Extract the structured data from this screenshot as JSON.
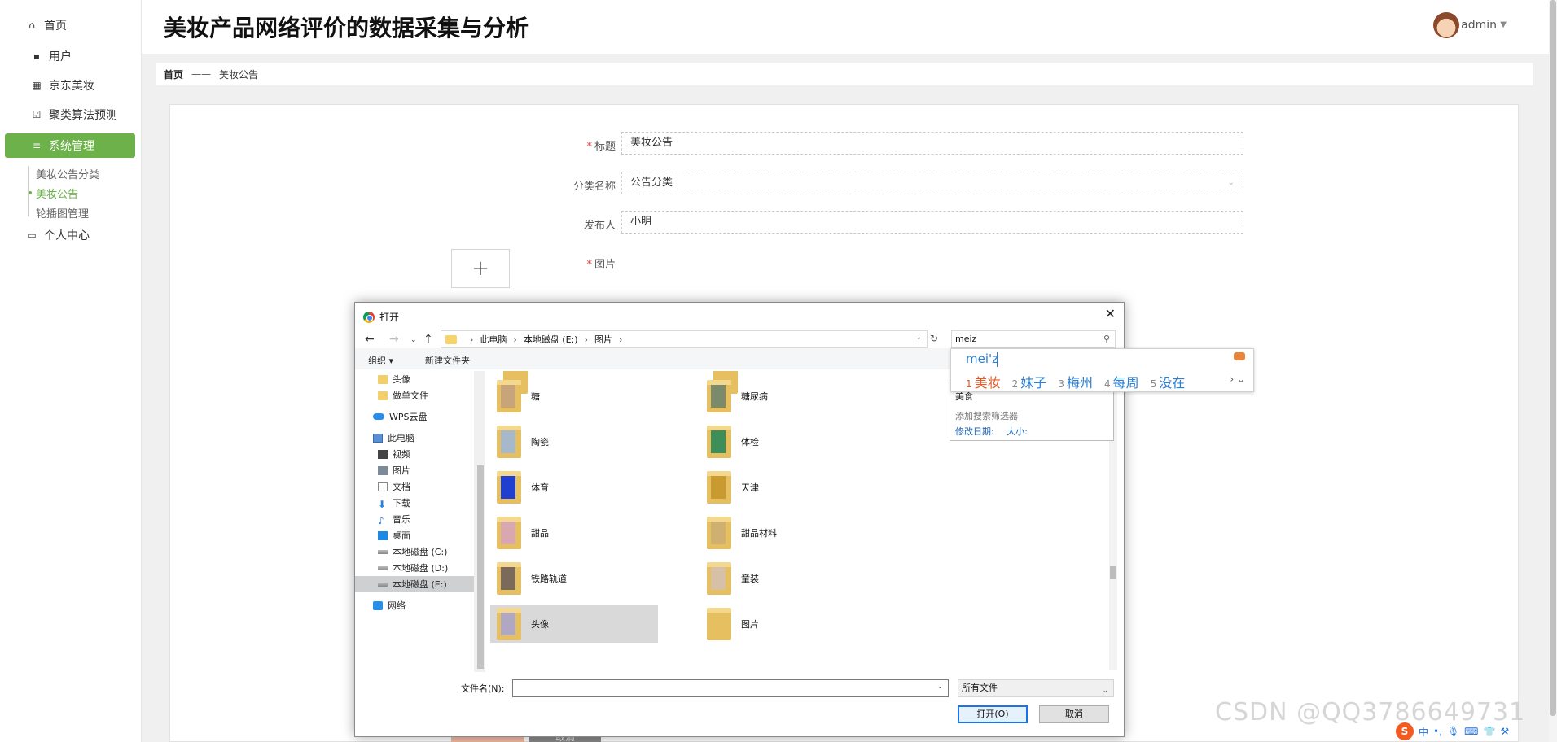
{
  "app": {
    "title": "美妆产品网络评价的数据采集与分析",
    "user": "admin"
  },
  "sidebar": {
    "items": [
      {
        "label": "首页",
        "icon": "home-icon"
      },
      {
        "label": "用户",
        "icon": "briefcase-icon"
      },
      {
        "label": "京东美妆",
        "icon": "grid-icon"
      },
      {
        "label": "聚类算法预测",
        "icon": "checkbox-icon"
      },
      {
        "label": "系统管理",
        "icon": "menu-icon"
      },
      {
        "label": "个人中心",
        "icon": "user-card-icon"
      }
    ],
    "sub_items": [
      "美妆公告分类",
      "美妆公告",
      "轮播图管理"
    ],
    "active_color": "#6cb14a"
  },
  "breadcrumb": {
    "home": "首页",
    "separator": "——",
    "current": "美妆公告"
  },
  "form": {
    "title_label": "标题",
    "title_value": "美妆公告",
    "category_label": "分类名称",
    "category_value": "公告分类",
    "publisher_label": "发布人",
    "publisher_value": "小明",
    "image_label": "图片",
    "upload_symbol": "+",
    "cancel_label": "取消"
  },
  "dialog": {
    "title": "打开",
    "path": [
      "此电脑",
      "本地磁盘 (E:)",
      "图片"
    ],
    "search_value": "meiz",
    "toolbar": {
      "organize": "组织",
      "new_folder": "新建文件夹"
    },
    "nav_items": [
      {
        "label": "头像",
        "icon": "folder-icon"
      },
      {
        "label": "做单文件",
        "icon": "folder-icon"
      },
      {
        "label": "WPS云盘",
        "icon": "cloud-icon"
      },
      {
        "label": "此电脑",
        "icon": "computer-icon"
      },
      {
        "label": "视频",
        "icon": "video-icon"
      },
      {
        "label": "图片",
        "icon": "image-icon"
      },
      {
        "label": "文档",
        "icon": "document-icon"
      },
      {
        "label": "下载",
        "icon": "download-icon"
      },
      {
        "label": "音乐",
        "icon": "music-icon"
      },
      {
        "label": "桌面",
        "icon": "desktop-icon"
      },
      {
        "label": "本地磁盘 (C:)",
        "icon": "drive-icon"
      },
      {
        "label": "本地磁盘 (D:)",
        "icon": "drive-icon"
      },
      {
        "label": "本地磁盘 (E:)",
        "icon": "drive-icon"
      },
      {
        "label": "网络",
        "icon": "network-icon"
      }
    ],
    "files": [
      {
        "name": "糖",
        "color": "#c8a47a"
      },
      {
        "name": "糖尿病",
        "color": "#7a8a6a"
      },
      {
        "name": "陶瓷",
        "color": "#a7b8c8"
      },
      {
        "name": "体检",
        "color": "#3e8e5a"
      },
      {
        "name": "体育",
        "color": "#1f3fd0"
      },
      {
        "name": "天津",
        "color": "#c89a30"
      },
      {
        "name": "甜品",
        "color": "#d8a7b0"
      },
      {
        "name": "甜品材料",
        "color": "#d0b070"
      },
      {
        "name": "铁路轨道",
        "color": "#7a6a5a"
      },
      {
        "name": "童装",
        "color": "#d6c0a8"
      },
      {
        "name": "头像",
        "color": "#b0a8c0"
      },
      {
        "name": "图片",
        "color": "#e6c060"
      }
    ],
    "filename_label": "文件名(N):",
    "filename_value": "",
    "filetype": "所有文件",
    "open_button": "打开(O)",
    "cancel_button": "取消",
    "suggest": {
      "text1": "美食",
      "text2": "添加搜索筛选器",
      "date_label": "修改日期:",
      "size_label": "大小:"
    }
  },
  "ime": {
    "composition": "mei'z",
    "candidates": [
      {
        "num": "1",
        "text": "美妆"
      },
      {
        "num": "2",
        "text": "妹子"
      },
      {
        "num": "3",
        "text": "梅州"
      },
      {
        "num": "4",
        "text": "每周"
      },
      {
        "num": "5",
        "text": "没在"
      }
    ]
  },
  "tray": {
    "lang": "中",
    "sogou": "S"
  },
  "watermark": "CSDN @QQ3786649731"
}
